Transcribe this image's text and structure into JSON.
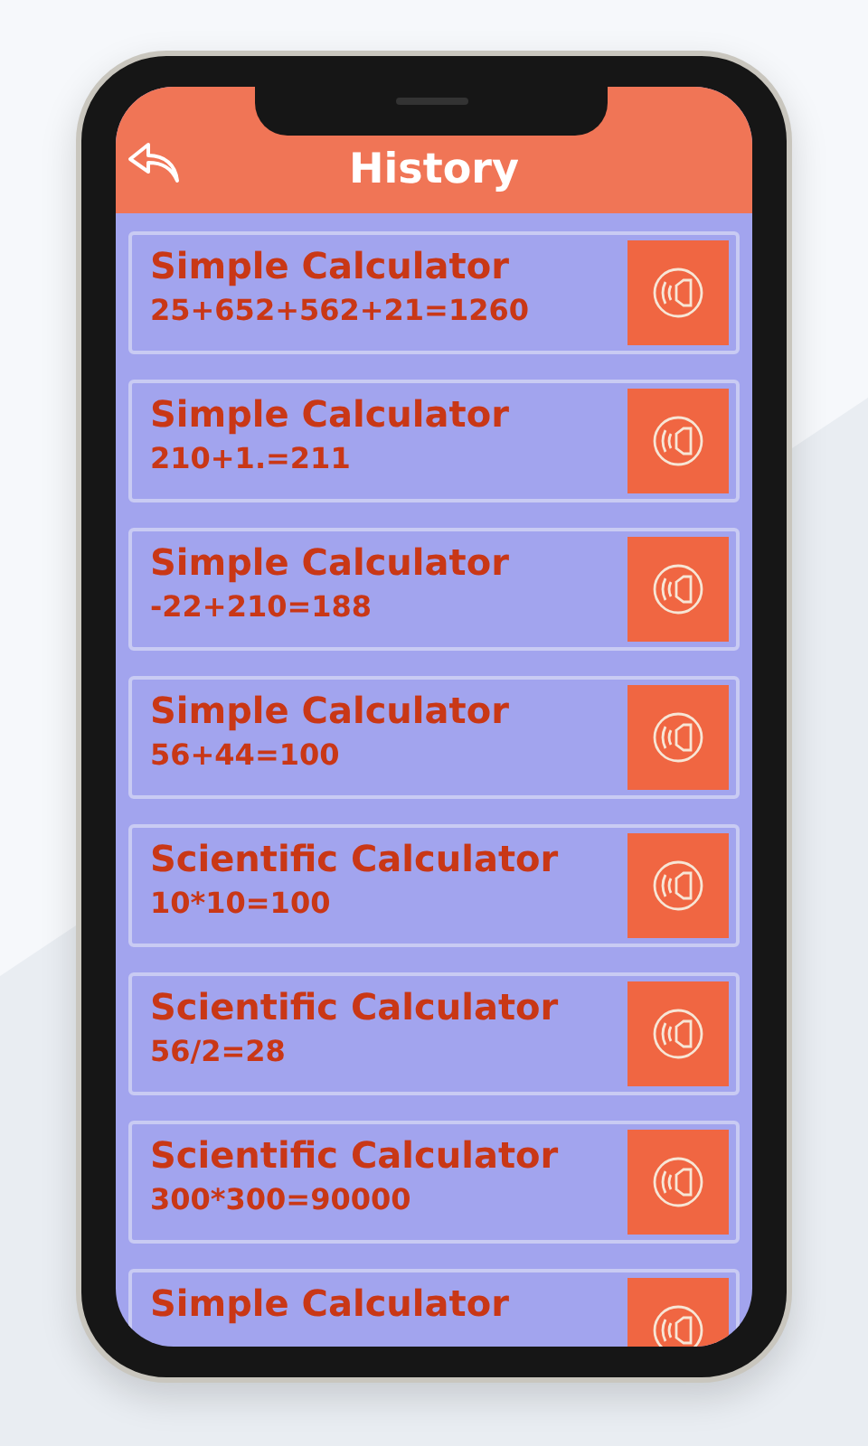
{
  "header": {
    "title": "History"
  },
  "history": [
    {
      "calculator": "Simple Calculator",
      "expression": "25+652+562+21=1260"
    },
    {
      "calculator": "Simple Calculator",
      "expression": "210+1.=211"
    },
    {
      "calculator": "Simple Calculator",
      "expression": "-22+210=188"
    },
    {
      "calculator": "Simple Calculator",
      "expression": "56+44=100"
    },
    {
      "calculator": "Scientific Calculator",
      "expression": "10*10=100"
    },
    {
      "calculator": "Scientific Calculator",
      "expression": "56/2=28"
    },
    {
      "calculator": "Scientific Calculator",
      "expression": "300*300=90000"
    },
    {
      "calculator": "Simple Calculator"
    }
  ]
}
